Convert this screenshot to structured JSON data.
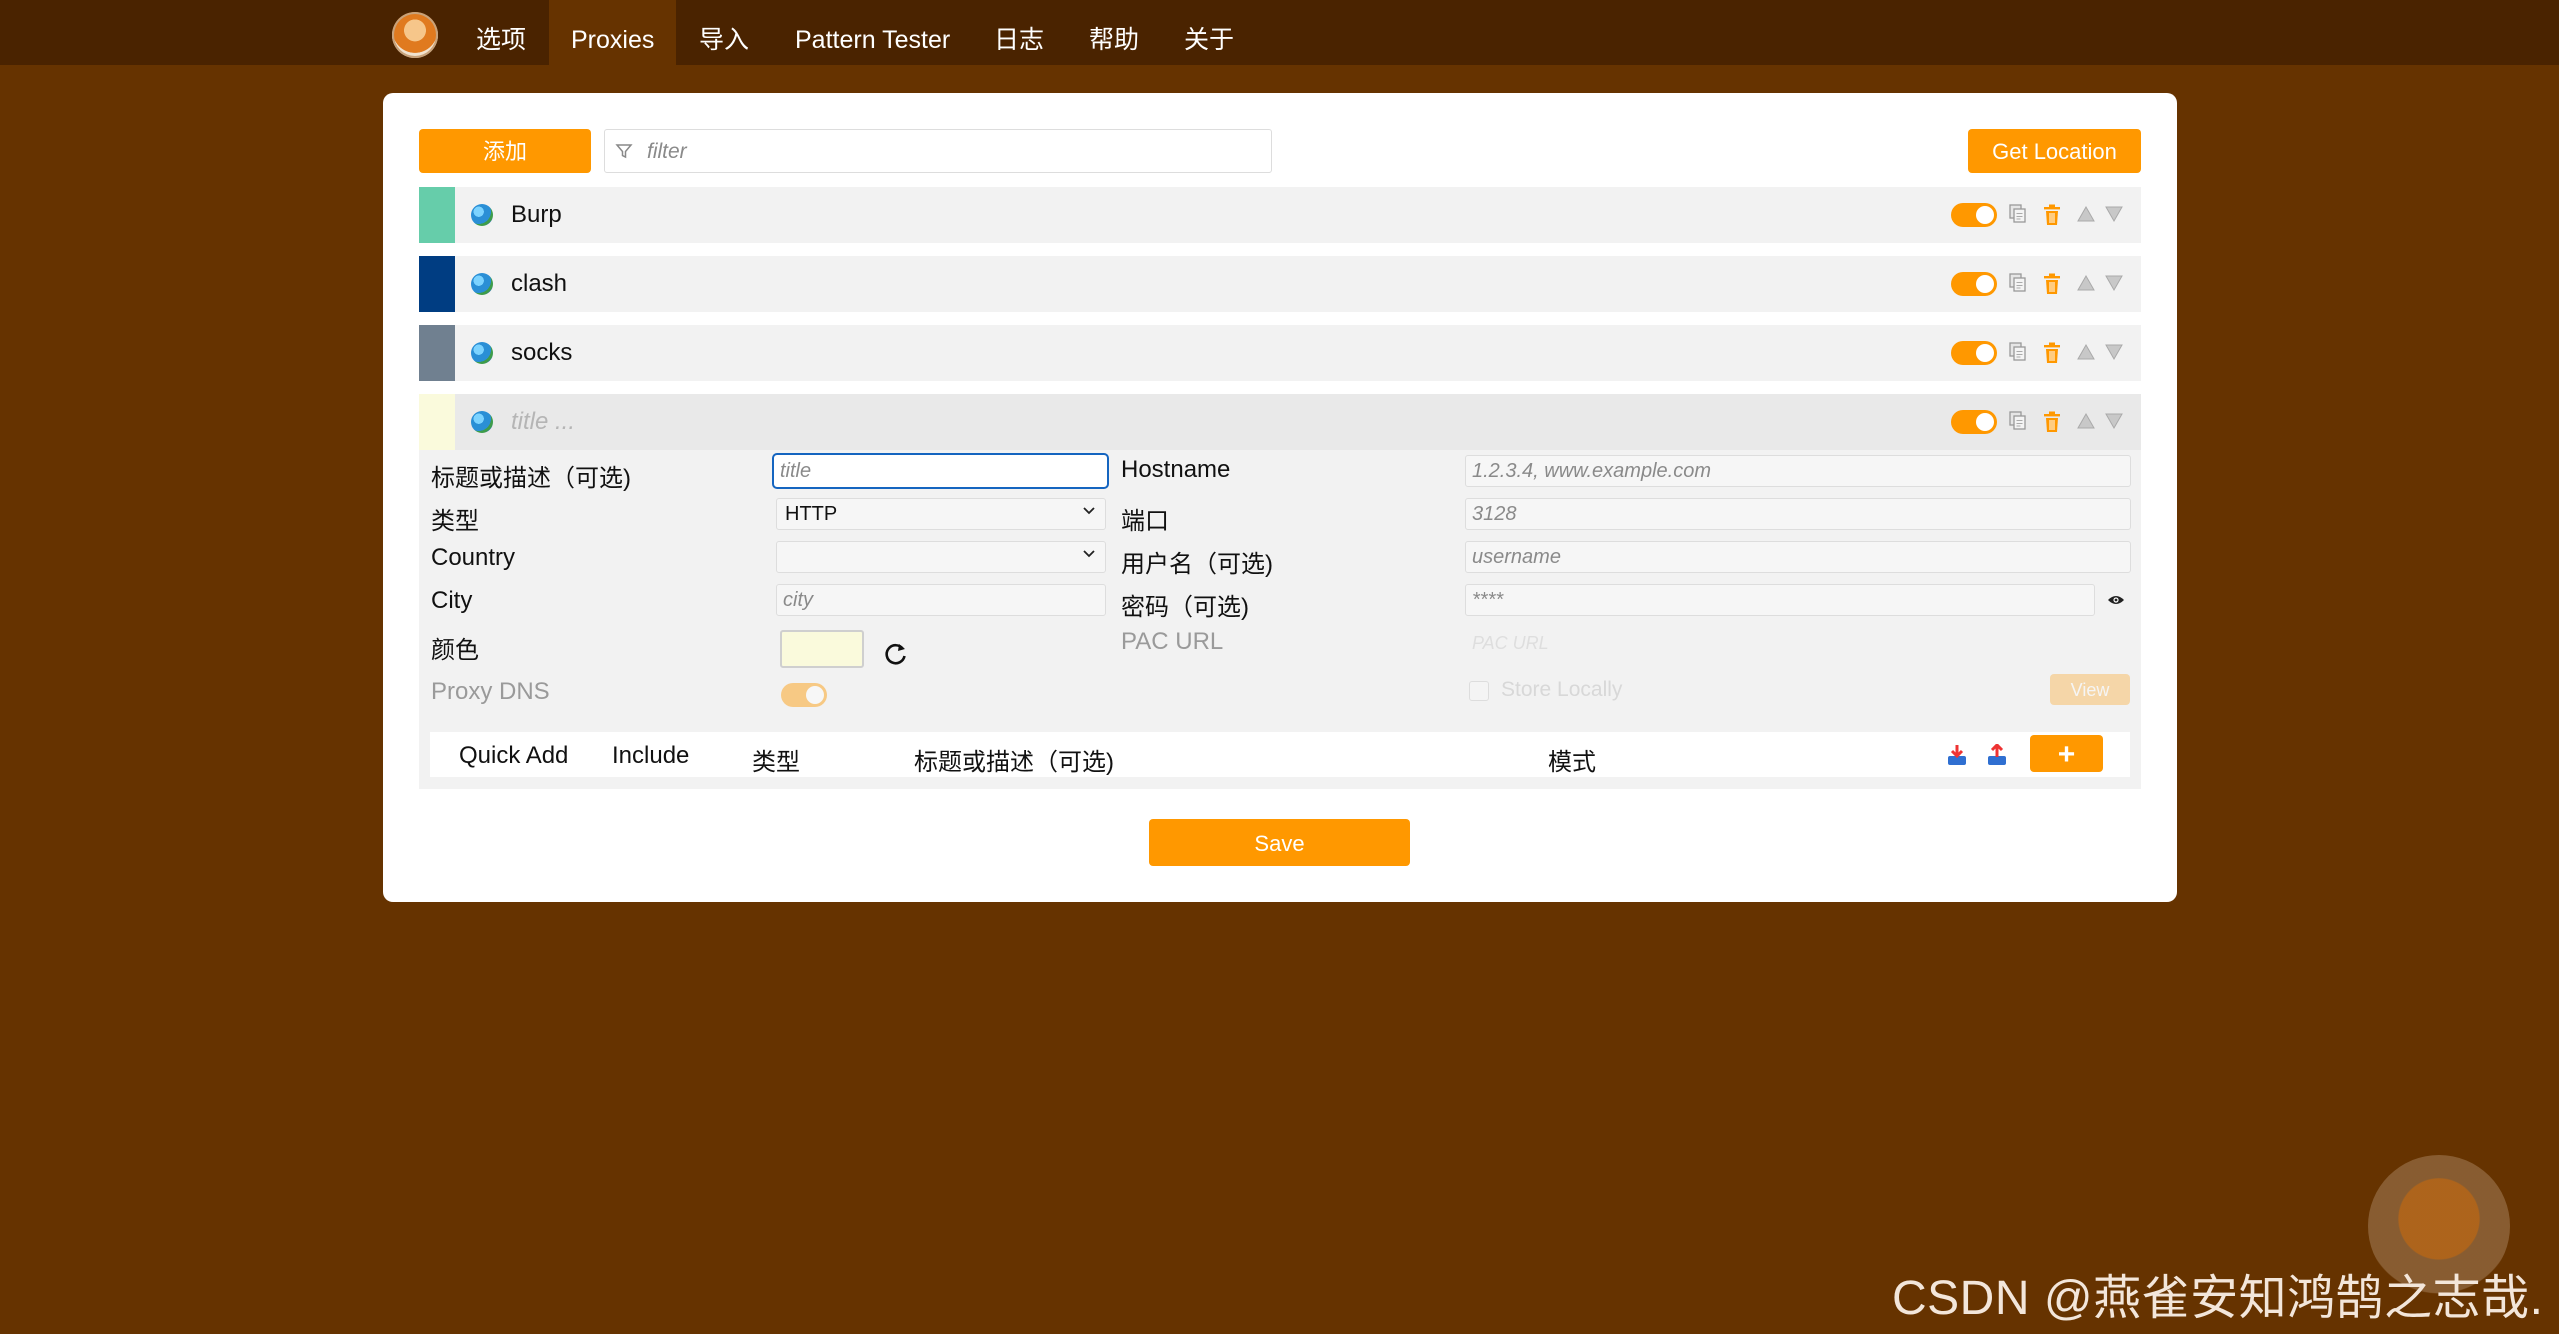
{
  "nav": {
    "items": [
      "选项",
      "Proxies",
      "导入",
      "Pattern Tester",
      "日志",
      "帮助",
      "关于"
    ],
    "active": "Proxies"
  },
  "toolbar": {
    "add_label": "添加",
    "filter_placeholder": "filter",
    "get_location_label": "Get Location"
  },
  "proxies": [
    {
      "title": "Burp",
      "color": "#66cdaa",
      "enabled": true
    },
    {
      "title": "clash",
      "color": "#003d82",
      "enabled": true
    },
    {
      "title": "socks",
      "color": "#708090",
      "enabled": true
    },
    {
      "title": "",
      "title_placeholder": "title ...",
      "color": "#fafadc",
      "enabled": true
    }
  ],
  "editor": {
    "title_label": "标题或描述（可选)",
    "title_placeholder": "title",
    "type_label": "类型",
    "type_value": "HTTP",
    "country_label": "Country",
    "country_value": "",
    "city_label": "City",
    "city_placeholder": "city",
    "color_label": "颜色",
    "color_value": "#fafadc",
    "proxy_dns_label": "Proxy DNS",
    "hostname_label": "Hostname",
    "hostname_placeholder": "1.2.3.4, www.example.com",
    "port_label": "端口",
    "port_placeholder": "3128",
    "username_label": "用户名（可选)",
    "username_placeholder": "username",
    "password_label": "密码（可选)",
    "password_placeholder": "****",
    "pac_url_label": "PAC URL",
    "pac_url_placeholder": "PAC URL",
    "store_locally_label": "Store Locally",
    "view_label": "View"
  },
  "patterns_header": {
    "quick_add": "Quick Add",
    "include": "Include",
    "type": "类型",
    "title": "标题或描述（可选)",
    "pattern": "模式",
    "add_symbol": "+"
  },
  "save_label": "Save",
  "watermark": "CSDN @燕雀安知鸿鹄之志哉.",
  "colors": {
    "background": "#663300",
    "topbar": "#4a2300",
    "accent": "#ff9800"
  }
}
